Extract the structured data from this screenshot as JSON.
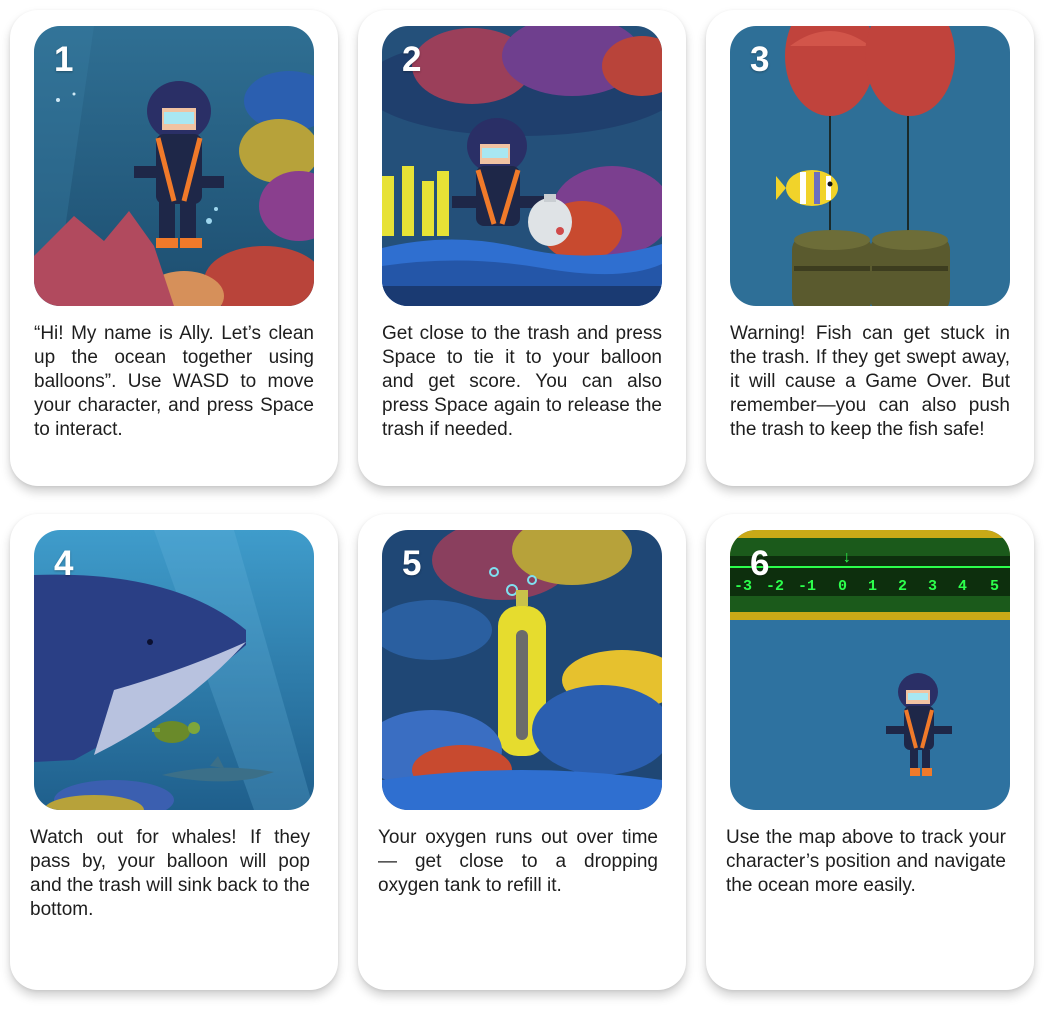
{
  "cards": [
    {
      "number": "1",
      "text": "“Hi! My name is Ally. Let’s clean up the ocean together using balloons”. Use WASD to move your character, and press Space to interact."
    },
    {
      "number": "2",
      "text": "Get close to the trash and press Space to tie it to your balloon and get score. You can also press Space again to release the trash if needed."
    },
    {
      "number": "3",
      "text": "Warning! Fish can get stuck in the trash. If they get swept away, it will cause a Game Over. But remember—you can also push the trash to keep the fish safe!"
    },
    {
      "number": "4",
      "text": "Watch out for whales! If they pass by, your balloon will pop and the trash will sink back to the bottom."
    },
    {
      "number": "5",
      "text": "Your oxygen runs out over time — get close to a dropping oxygen tank to refill it."
    },
    {
      "number": "6",
      "text": "Use the map above to track your character’s position and navigate the ocean more easily."
    }
  ],
  "depth_map": {
    "ticks": [
      "-3",
      "-2",
      "-1",
      "0",
      "1",
      "2",
      "3",
      "4",
      "5"
    ],
    "marker": "↓"
  },
  "colors": {
    "ocean": "#2f6f93",
    "coral_red": "#c0433c",
    "coral_yellow": "#d9c63a",
    "suit_orange": "#f07a2a",
    "map_green": "#2cff4c"
  }
}
